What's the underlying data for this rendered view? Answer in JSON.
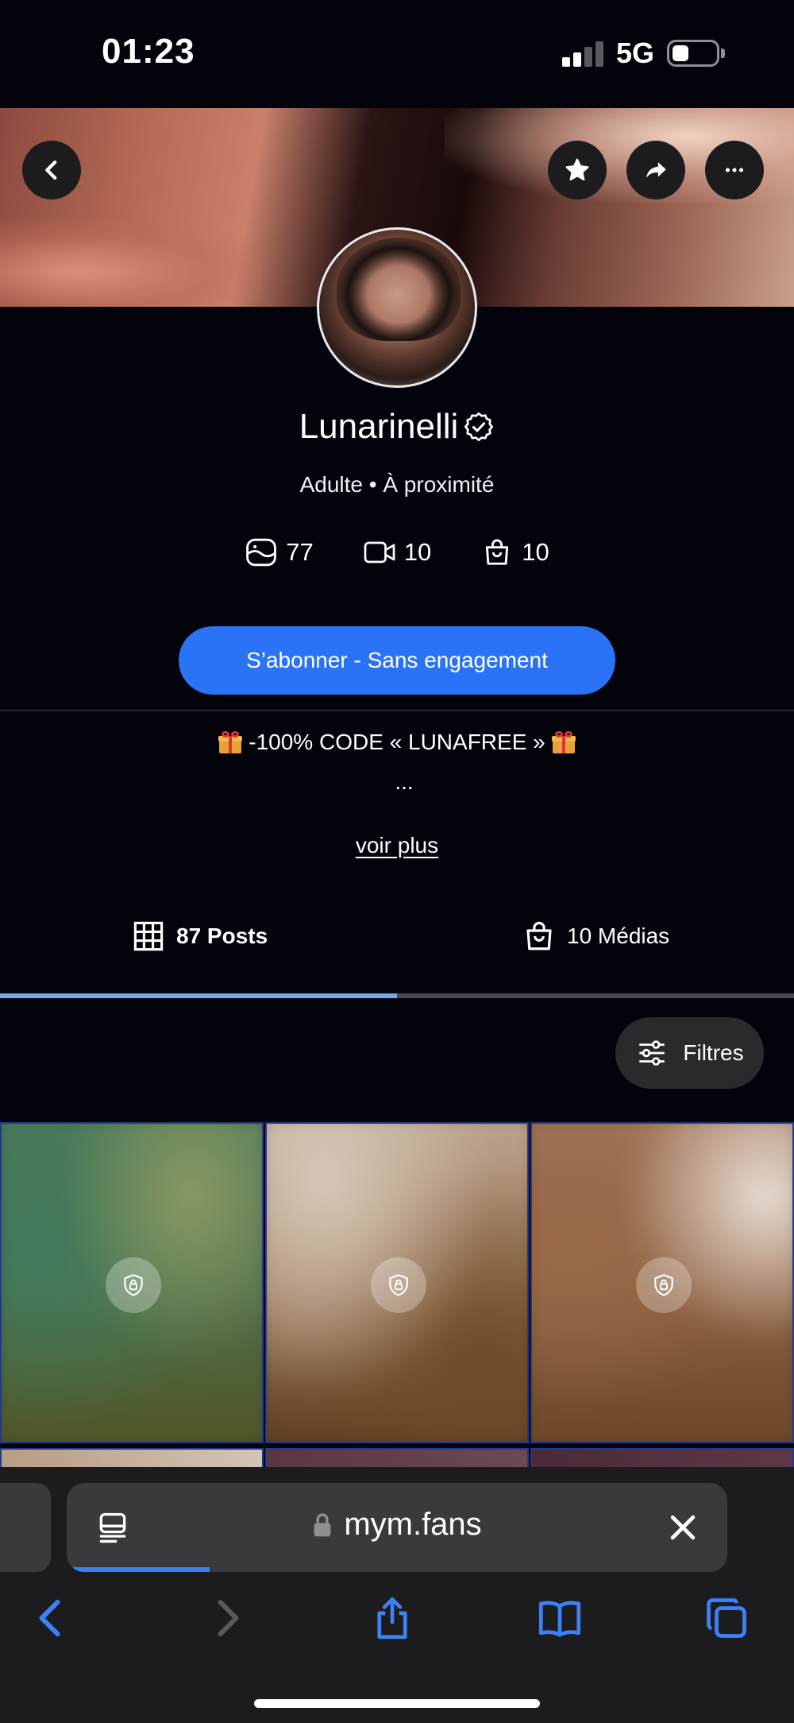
{
  "status_bar": {
    "time": "01:23",
    "network": "5G"
  },
  "banner": {
    "back_icon": "chevron-left-icon",
    "favorite_icon": "star-icon",
    "share_icon": "share-arrow-icon",
    "more_icon": "ellipsis-icon"
  },
  "profile": {
    "name": "Lunarinelli",
    "subtitle": "Adulte • À proximité",
    "stats": {
      "photos": "77",
      "videos": "10",
      "shop": "10"
    },
    "subscribe_label": "S’abonner - Sans engagement",
    "promo_text": "-100% CODE « LUNAFREE »",
    "bio_ellipsis": "...",
    "see_more_label": "voir plus"
  },
  "tabs": [
    {
      "label": "87 Posts",
      "icon": "grid-icon",
      "active": true
    },
    {
      "label": "10 Médias",
      "icon": "shopping-bag-icon",
      "active": false
    }
  ],
  "filters_label": "Filtres",
  "browser": {
    "url": "mym.fans",
    "colors": {
      "accent": "#2a73f6",
      "link_blue": "#3b82f6"
    }
  }
}
